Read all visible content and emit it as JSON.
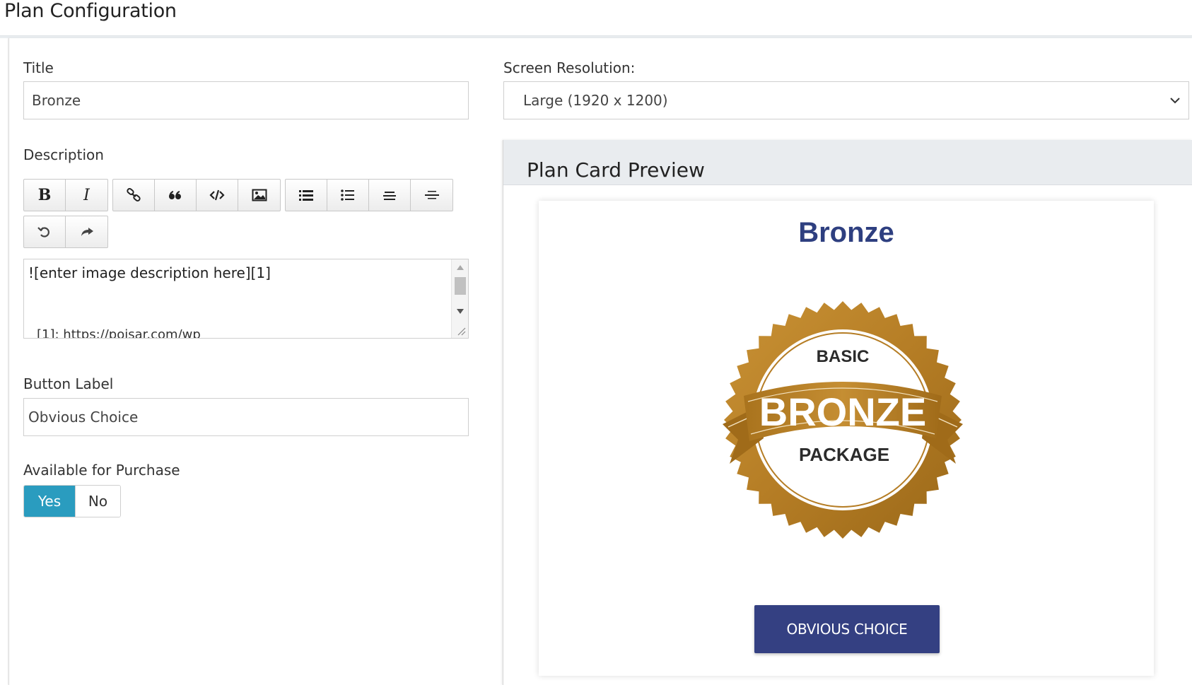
{
  "page": {
    "title": "Plan Configuration"
  },
  "form": {
    "title_label": "Title",
    "title_value": "Bronze",
    "resolution_label": "Screen Resolution:",
    "resolution_value": "Large (1920 x 1200)",
    "description_label": "Description",
    "description_line1": "![enter image description here][1]",
    "description_line2": "[1]: https://poisar.com/wp",
    "button_label_label": "Button Label",
    "button_label_value": "Obvious Choice",
    "available_label": "Available for Purchase",
    "available_yes": "Yes",
    "available_no": "No",
    "available_selected": "Yes"
  },
  "toolbar": {
    "bold": "B",
    "italic": "I",
    "icons": [
      "bold-icon",
      "italic-icon",
      "link-icon",
      "blockquote-icon",
      "code-icon",
      "image-icon",
      "numbered-list-icon",
      "bulleted-list-icon",
      "heading-icon",
      "horizontal-rule-icon",
      "undo-icon",
      "redo-icon"
    ]
  },
  "preview": {
    "heading": "Plan Card Preview",
    "card_title": "Bronze",
    "badge_top": "BASIC",
    "badge_middle": "BRONZE",
    "badge_bottom": "PACKAGE",
    "button_text": "OBVIOUS CHOICE"
  },
  "colors": {
    "accent": "#2a9cbf",
    "card_title": "#2e3f80",
    "card_button": "#344082",
    "bronze": "#b57d25"
  }
}
